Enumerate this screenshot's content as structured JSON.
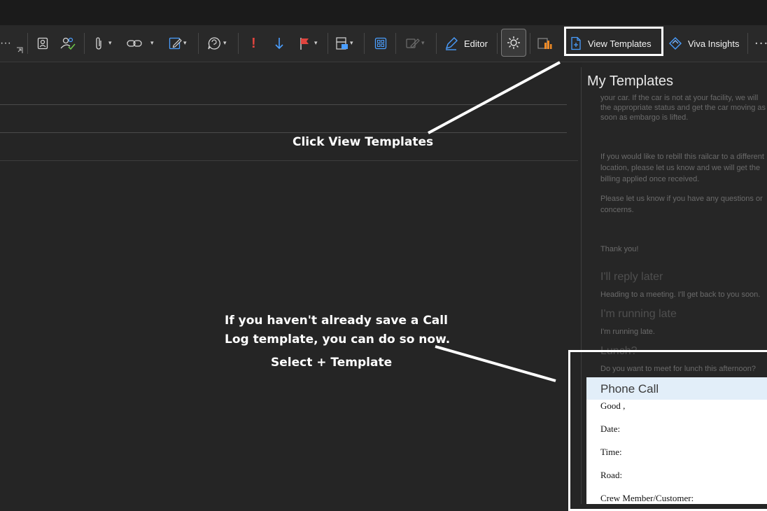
{
  "ribbon": {
    "editor_label": "Editor",
    "view_templates_label": "View Templates",
    "viva_insights_label": "Viva Insights",
    "more_label": "···",
    "overflow_label": "···",
    "important_label": "!",
    "colors": {
      "accent_blue": "#4a9eff",
      "important_red": "#e0443e",
      "flag_red": "#e0443e"
    }
  },
  "pane": {
    "title": "My Templates",
    "frag_1": "your car. If the car is not at your facility, we will",
    "frag_2": "the appropriate status and get the car moving as",
    "frag_3": "soon as embargo is lifted.",
    "frag_4": "If you would like to rebill this railcar to a different",
    "frag_5": "location, please let us know and we will get the",
    "frag_6": "billing applied once received.",
    "frag_7": "Please let us know if you have any questions or",
    "frag_8": "concerns.",
    "frag_9": "Thank you!",
    "reply_later_title": "I'll reply later",
    "reply_later_body": "Heading to a meeting. I'll get back to you soon.",
    "running_late_title": "I'm running late",
    "running_late_body": "I'm running late.",
    "lunch_title": "Lunch?",
    "lunch_body": "Do you want to meet for lunch this afternoon?",
    "phone_call": {
      "title": "Phone Call",
      "lines": [
        "Good ,",
        "Date:",
        "Time:",
        "Road:",
        "Crew Member/Customer:"
      ]
    }
  },
  "annotations": {
    "click_view_templates": "Click View Templates",
    "save_line_1": "If you haven't already save a Call",
    "save_line_2": "Log template, you can do so now.",
    "select_template": "Select + Template"
  }
}
